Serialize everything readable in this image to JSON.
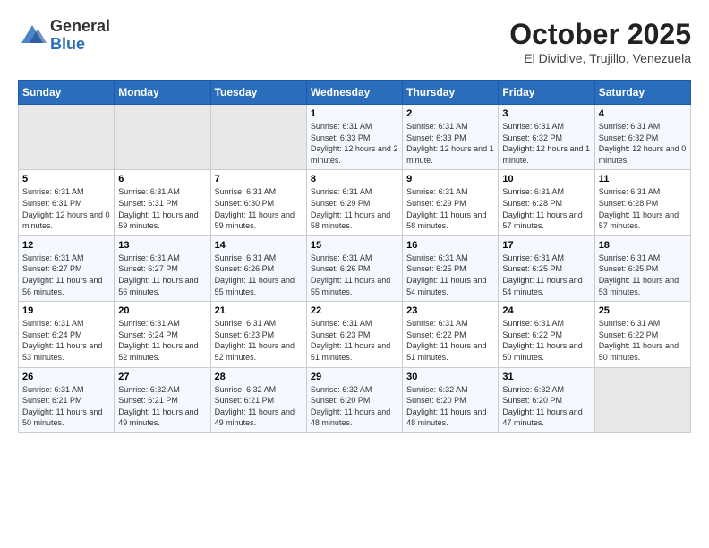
{
  "header": {
    "logo": {
      "general": "General",
      "blue": "Blue"
    },
    "title": "October 2025",
    "location": "El Dividive, Trujillo, Venezuela"
  },
  "calendar": {
    "days_of_week": [
      "Sunday",
      "Monday",
      "Tuesday",
      "Wednesday",
      "Thursday",
      "Friday",
      "Saturday"
    ],
    "weeks": [
      [
        {
          "day": "",
          "sunrise": "",
          "sunset": "",
          "daylight": "",
          "empty": true
        },
        {
          "day": "",
          "sunrise": "",
          "sunset": "",
          "daylight": "",
          "empty": true
        },
        {
          "day": "",
          "sunrise": "",
          "sunset": "",
          "daylight": "",
          "empty": true
        },
        {
          "day": "1",
          "sunrise": "Sunrise: 6:31 AM",
          "sunset": "Sunset: 6:33 PM",
          "daylight": "Daylight: 12 hours and 2 minutes.",
          "empty": false
        },
        {
          "day": "2",
          "sunrise": "Sunrise: 6:31 AM",
          "sunset": "Sunset: 6:33 PM",
          "daylight": "Daylight: 12 hours and 1 minute.",
          "empty": false
        },
        {
          "day": "3",
          "sunrise": "Sunrise: 6:31 AM",
          "sunset": "Sunset: 6:32 PM",
          "daylight": "Daylight: 12 hours and 1 minute.",
          "empty": false
        },
        {
          "day": "4",
          "sunrise": "Sunrise: 6:31 AM",
          "sunset": "Sunset: 6:32 PM",
          "daylight": "Daylight: 12 hours and 0 minutes.",
          "empty": false
        }
      ],
      [
        {
          "day": "5",
          "sunrise": "Sunrise: 6:31 AM",
          "sunset": "Sunset: 6:31 PM",
          "daylight": "Daylight: 12 hours and 0 minutes.",
          "empty": false
        },
        {
          "day": "6",
          "sunrise": "Sunrise: 6:31 AM",
          "sunset": "Sunset: 6:31 PM",
          "daylight": "Daylight: 11 hours and 59 minutes.",
          "empty": false
        },
        {
          "day": "7",
          "sunrise": "Sunrise: 6:31 AM",
          "sunset": "Sunset: 6:30 PM",
          "daylight": "Daylight: 11 hours and 59 minutes.",
          "empty": false
        },
        {
          "day": "8",
          "sunrise": "Sunrise: 6:31 AM",
          "sunset": "Sunset: 6:29 PM",
          "daylight": "Daylight: 11 hours and 58 minutes.",
          "empty": false
        },
        {
          "day": "9",
          "sunrise": "Sunrise: 6:31 AM",
          "sunset": "Sunset: 6:29 PM",
          "daylight": "Daylight: 11 hours and 58 minutes.",
          "empty": false
        },
        {
          "day": "10",
          "sunrise": "Sunrise: 6:31 AM",
          "sunset": "Sunset: 6:28 PM",
          "daylight": "Daylight: 11 hours and 57 minutes.",
          "empty": false
        },
        {
          "day": "11",
          "sunrise": "Sunrise: 6:31 AM",
          "sunset": "Sunset: 6:28 PM",
          "daylight": "Daylight: 11 hours and 57 minutes.",
          "empty": false
        }
      ],
      [
        {
          "day": "12",
          "sunrise": "Sunrise: 6:31 AM",
          "sunset": "Sunset: 6:27 PM",
          "daylight": "Daylight: 11 hours and 56 minutes.",
          "empty": false
        },
        {
          "day": "13",
          "sunrise": "Sunrise: 6:31 AM",
          "sunset": "Sunset: 6:27 PM",
          "daylight": "Daylight: 11 hours and 56 minutes.",
          "empty": false
        },
        {
          "day": "14",
          "sunrise": "Sunrise: 6:31 AM",
          "sunset": "Sunset: 6:26 PM",
          "daylight": "Daylight: 11 hours and 55 minutes.",
          "empty": false
        },
        {
          "day": "15",
          "sunrise": "Sunrise: 6:31 AM",
          "sunset": "Sunset: 6:26 PM",
          "daylight": "Daylight: 11 hours and 55 minutes.",
          "empty": false
        },
        {
          "day": "16",
          "sunrise": "Sunrise: 6:31 AM",
          "sunset": "Sunset: 6:25 PM",
          "daylight": "Daylight: 11 hours and 54 minutes.",
          "empty": false
        },
        {
          "day": "17",
          "sunrise": "Sunrise: 6:31 AM",
          "sunset": "Sunset: 6:25 PM",
          "daylight": "Daylight: 11 hours and 54 minutes.",
          "empty": false
        },
        {
          "day": "18",
          "sunrise": "Sunrise: 6:31 AM",
          "sunset": "Sunset: 6:25 PM",
          "daylight": "Daylight: 11 hours and 53 minutes.",
          "empty": false
        }
      ],
      [
        {
          "day": "19",
          "sunrise": "Sunrise: 6:31 AM",
          "sunset": "Sunset: 6:24 PM",
          "daylight": "Daylight: 11 hours and 53 minutes.",
          "empty": false
        },
        {
          "day": "20",
          "sunrise": "Sunrise: 6:31 AM",
          "sunset": "Sunset: 6:24 PM",
          "daylight": "Daylight: 11 hours and 52 minutes.",
          "empty": false
        },
        {
          "day": "21",
          "sunrise": "Sunrise: 6:31 AM",
          "sunset": "Sunset: 6:23 PM",
          "daylight": "Daylight: 11 hours and 52 minutes.",
          "empty": false
        },
        {
          "day": "22",
          "sunrise": "Sunrise: 6:31 AM",
          "sunset": "Sunset: 6:23 PM",
          "daylight": "Daylight: 11 hours and 51 minutes.",
          "empty": false
        },
        {
          "day": "23",
          "sunrise": "Sunrise: 6:31 AM",
          "sunset": "Sunset: 6:22 PM",
          "daylight": "Daylight: 11 hours and 51 minutes.",
          "empty": false
        },
        {
          "day": "24",
          "sunrise": "Sunrise: 6:31 AM",
          "sunset": "Sunset: 6:22 PM",
          "daylight": "Daylight: 11 hours and 50 minutes.",
          "empty": false
        },
        {
          "day": "25",
          "sunrise": "Sunrise: 6:31 AM",
          "sunset": "Sunset: 6:22 PM",
          "daylight": "Daylight: 11 hours and 50 minutes.",
          "empty": false
        }
      ],
      [
        {
          "day": "26",
          "sunrise": "Sunrise: 6:31 AM",
          "sunset": "Sunset: 6:21 PM",
          "daylight": "Daylight: 11 hours and 50 minutes.",
          "empty": false
        },
        {
          "day": "27",
          "sunrise": "Sunrise: 6:32 AM",
          "sunset": "Sunset: 6:21 PM",
          "daylight": "Daylight: 11 hours and 49 minutes.",
          "empty": false
        },
        {
          "day": "28",
          "sunrise": "Sunrise: 6:32 AM",
          "sunset": "Sunset: 6:21 PM",
          "daylight": "Daylight: 11 hours and 49 minutes.",
          "empty": false
        },
        {
          "day": "29",
          "sunrise": "Sunrise: 6:32 AM",
          "sunset": "Sunset: 6:20 PM",
          "daylight": "Daylight: 11 hours and 48 minutes.",
          "empty": false
        },
        {
          "day": "30",
          "sunrise": "Sunrise: 6:32 AM",
          "sunset": "Sunset: 6:20 PM",
          "daylight": "Daylight: 11 hours and 48 minutes.",
          "empty": false
        },
        {
          "day": "31",
          "sunrise": "Sunrise: 6:32 AM",
          "sunset": "Sunset: 6:20 PM",
          "daylight": "Daylight: 11 hours and 47 minutes.",
          "empty": false
        },
        {
          "day": "",
          "sunrise": "",
          "sunset": "",
          "daylight": "",
          "empty": true
        }
      ]
    ]
  }
}
